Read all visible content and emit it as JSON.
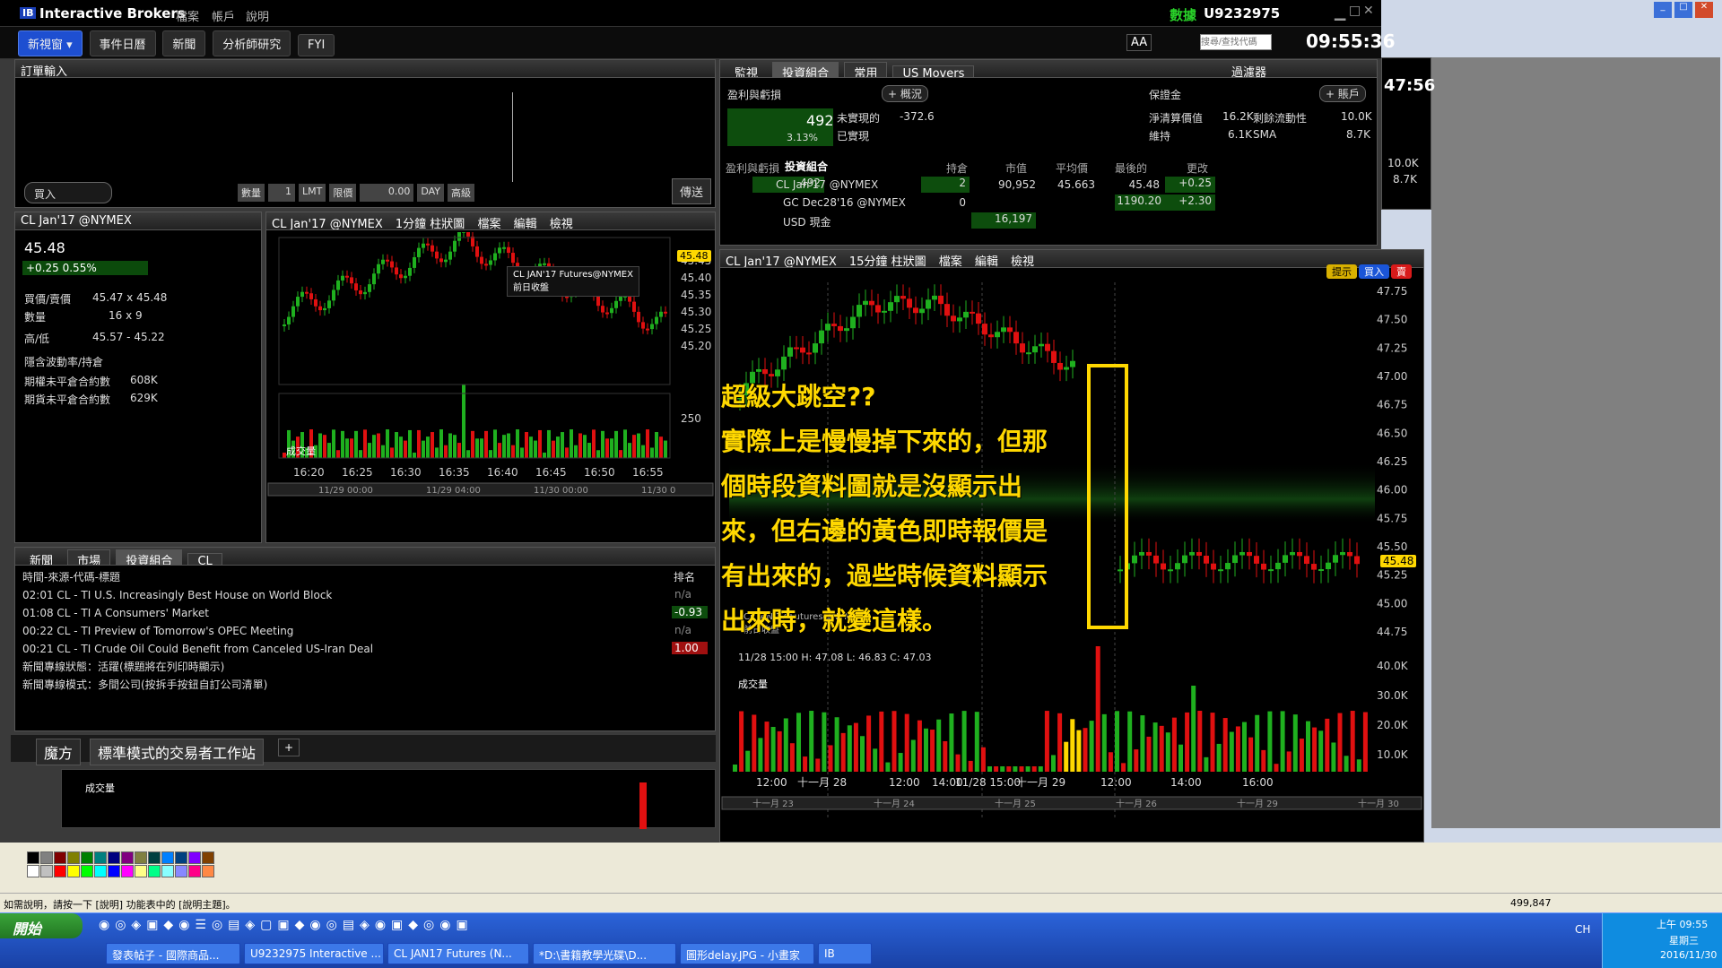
{
  "app": {
    "title": "Interactive Brokers",
    "menus": [
      "檔案",
      "帳戶",
      "說明"
    ],
    "account": "U9232975",
    "data_label": "數據",
    "clock": "09:55:36",
    "clock2": "47:56",
    "search_placeholder": "搜尋/查找代碼"
  },
  "toolbar": {
    "new_window": "新視窗",
    "items": [
      "事件日曆",
      "新聞",
      "分析師研究",
      "FYI"
    ]
  },
  "order_entry": {
    "title": "訂單輸入",
    "buy": "買入",
    "qty_label": "數量",
    "qty": "1",
    "type": "LMT",
    "limit_label": "限價",
    "limit": "0.00",
    "tif": "DAY",
    "adv": "高級",
    "transmit": "傳送"
  },
  "quote": {
    "symbol": "CL Jan'17 @NYMEX",
    "price": "45.48",
    "change": "+0.25",
    "change_pct": "0.55%",
    "bidask_label": "買價/賣價",
    "bidask": "45.47 x 45.48",
    "size_label": "數量",
    "size": "16 x 9",
    "hilo_label": "高/低",
    "hilo": "45.57 - 45.22",
    "iv_label": "隱含波動率/持倉",
    "oi1_label": "期權未平倉合約數",
    "oi1": "608K",
    "oi2_label": "期貨未平倉合約數",
    "oi2": "629K"
  },
  "mini_chart": {
    "title": "CL Jan'17 @NYMEX",
    "period": "1分鐘 柱狀圖",
    "menus": [
      "檔案",
      "編輯",
      "檢視"
    ],
    "legend": "CL JAN'17 Futures@NYMEX",
    "prev_close": "前日收盤",
    "price_tag": "45.48",
    "y_ticks": [
      "45.45",
      "45.40",
      "45.35",
      "45.30",
      "45.25",
      "45.20"
    ],
    "vol_label": "成交量",
    "vol_tick": "250",
    "x_ticks": [
      "16:20",
      "16:25",
      "16:30",
      "16:35",
      "16:40",
      "16:45",
      "16:50",
      "16:55"
    ],
    "nav_dates": [
      "11/29 00:00",
      "11/29 04:00",
      "11/30 00:00",
      "11/30 0"
    ]
  },
  "monitor": {
    "title": "監視",
    "tabs": [
      "投資組合",
      "常用",
      "US Movers"
    ],
    "filter": "過濾器",
    "pnl_label": "盈利與虧損",
    "overview": "概況",
    "pnl_value": "492",
    "pnl_pct": "3.13%",
    "unrealized_label": "未實現的",
    "unrealized": "-372.6",
    "realized_label": "已實現",
    "margin_label": "保證金",
    "account_btn": "賬戶",
    "net_liq_label": "淨清算價值",
    "net_liq": "16.2K",
    "excess_label": "剩餘流動性",
    "excess": "10.0K",
    "maint_label": "維持",
    "maint": "6.1K",
    "sma_label": "SMA",
    "sma": "8.7K",
    "table_headers": [
      "盈利與虧損",
      "投資組合",
      "持倉",
      "市值",
      "平均價",
      "最後的",
      "更改"
    ],
    "rows": [
      {
        "pnl": "492",
        "name": "CL Jan'17 @NYMEX",
        "pos": "2",
        "mv": "90,952",
        "avg": "45.663",
        "last": "45.48",
        "chg": "+0.25"
      },
      {
        "pnl": "",
        "name": "GC Dec28'16 @NYMEX",
        "pos": "0",
        "mv": "",
        "avg": "",
        "last": "1190.20",
        "chg": "+2.30"
      },
      {
        "pnl": "",
        "name": "USD 現金",
        "pos": "",
        "mv": "16,197",
        "avg": "",
        "last": "",
        "chg": ""
      }
    ]
  },
  "news": {
    "title": "新聞",
    "tabs": [
      "市場",
      "投資組合",
      "CL"
    ],
    "header": "時間-來源-代碼-標題",
    "rank_header": "排名",
    "items": [
      {
        "t": "02:01",
        "text": "CL - TI U.S. Increasingly Best House on World Block",
        "rank": "n/a"
      },
      {
        "t": "01:08",
        "text": "CL - TI A Consumers' Market",
        "rank": "-0.93"
      },
      {
        "t": "00:22",
        "text": "CL - TI Preview of Tomorrow's OPEC Meeting",
        "rank": "n/a"
      },
      {
        "t": "00:21",
        "text": "CL - TI Crude Oil Could Benefit from Canceled US-Iran Deal",
        "rank": "1.00"
      }
    ],
    "status1": "新聞專線狀態：活躍(標題將在列印時顯示)",
    "status2": "新聞專線模式：多間公司(按拆手按鈕自訂公司清單)"
  },
  "workspace_tabs": [
    "魔方",
    "標準模式的交易者工作站"
  ],
  "main_chart": {
    "title": "CL Jan'17 @NYMEX",
    "period": "15分鐘 柱狀圖",
    "menus": [
      "檔案",
      "編輯",
      "檢視"
    ],
    "hint": "提示",
    "buy": "買入",
    "sell": "賣",
    "price_tag": "45.48",
    "y_ticks": [
      "47.75",
      "47.50",
      "47.25",
      "47.00",
      "46.75",
      "46.50",
      "46.25",
      "46.00",
      "45.75",
      "45.50",
      "45.25",
      "45.00",
      "44.75"
    ],
    "info": "11/28 15:00   H: 47.08   L: 46.83   C: 47.03",
    "vol_label": "成交量",
    "vol_ticks": [
      "40.0K",
      "30.0K",
      "20.0K",
      "10.0K"
    ],
    "x_ticks": [
      "12:00",
      "十一月 28",
      "12:00",
      "14:00",
      "11/28 15:00",
      "十一月 29",
      "12:00",
      "14:00",
      "16:00"
    ],
    "nav_dates": [
      "十一月 23",
      "十一月 24",
      "十一月 25",
      "十一月 26",
      "十一月 29",
      "十一月 30"
    ],
    "legend": "CL JAN'17 Futures@NYMEX",
    "prev_close": "前日收盤"
  },
  "annotation": {
    "lines": [
      "超級大跳空??",
      "實際上是慢慢掉下來的，但那",
      "個時段資料圖就是沒顯示出",
      "來，但右邊的黃色即時報價是",
      "有出來的，過些時候資料顯示",
      "出來時，就變這樣。"
    ]
  },
  "bottom_vol": {
    "label": "成交量"
  },
  "statusbar": {
    "help": "如需說明，請按一下 [說明] 功能表中的 [說明主題]。",
    "coords": "499,847"
  },
  "taskbar": {
    "start": "開始",
    "tasks": [
      "發表帖子 - 國際商品...",
      "U9232975 Interactive ...",
      "CL JAN17 Futures (N...",
      "*D:\\書籍教學光碟\\D...",
      "圖形delay.JPG - 小畫家",
      "IB"
    ],
    "lang": "CH",
    "time": "上午 09:55",
    "weekday": "星期三",
    "date": "2016/11/30"
  },
  "colors": {
    "up": "#1fb01f",
    "down": "#e01010",
    "accent": "#ffd800"
  }
}
